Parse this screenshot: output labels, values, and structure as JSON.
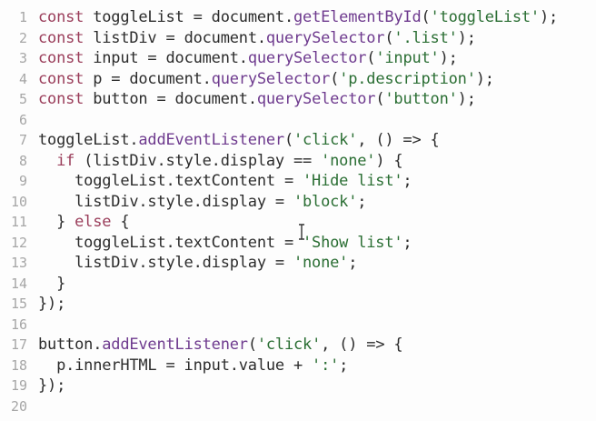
{
  "editor": {
    "language": "javascript",
    "colors": {
      "background": "#fdfdfd",
      "line_number": "#a6a6a6",
      "keyword": "#9a3d5a",
      "function": "#6e3a8e",
      "string": "#2a6e33",
      "default": "#2c2c2c"
    },
    "lines": [
      {
        "n": "1",
        "tokens": [
          [
            "kw",
            "const"
          ],
          [
            "plain",
            " toggleList = document."
          ],
          [
            "fn",
            "getElementById"
          ],
          [
            "plain",
            "("
          ],
          [
            "str",
            "'toggleList'"
          ],
          [
            "plain",
            ");"
          ]
        ]
      },
      {
        "n": "2",
        "tokens": [
          [
            "kw",
            "const"
          ],
          [
            "plain",
            " listDiv = document."
          ],
          [
            "fn",
            "querySelector"
          ],
          [
            "plain",
            "("
          ],
          [
            "str",
            "'.list'"
          ],
          [
            "plain",
            ");"
          ]
        ]
      },
      {
        "n": "3",
        "tokens": [
          [
            "kw",
            "const"
          ],
          [
            "plain",
            " input = document."
          ],
          [
            "fn",
            "querySelector"
          ],
          [
            "plain",
            "("
          ],
          [
            "str",
            "'input'"
          ],
          [
            "plain",
            ");"
          ]
        ]
      },
      {
        "n": "4",
        "tokens": [
          [
            "kw",
            "const"
          ],
          [
            "plain",
            " p = document."
          ],
          [
            "fn",
            "querySelector"
          ],
          [
            "plain",
            "("
          ],
          [
            "str",
            "'p.description'"
          ],
          [
            "plain",
            ");"
          ]
        ]
      },
      {
        "n": "5",
        "tokens": [
          [
            "kw",
            "const"
          ],
          [
            "plain",
            " button = document."
          ],
          [
            "fn",
            "querySelector"
          ],
          [
            "plain",
            "("
          ],
          [
            "str",
            "'button'"
          ],
          [
            "plain",
            ");"
          ]
        ]
      },
      {
        "n": "6",
        "tokens": []
      },
      {
        "n": "7",
        "tokens": [
          [
            "plain",
            "toggleList."
          ],
          [
            "fn",
            "addEventListener"
          ],
          [
            "plain",
            "("
          ],
          [
            "str",
            "'click'"
          ],
          [
            "plain",
            ", () => {"
          ]
        ]
      },
      {
        "n": "8",
        "tokens": [
          [
            "plain",
            "  "
          ],
          [
            "kw",
            "if"
          ],
          [
            "plain",
            " (listDiv.style.display == "
          ],
          [
            "str",
            "'none'"
          ],
          [
            "plain",
            ") {"
          ]
        ]
      },
      {
        "n": "9",
        "tokens": [
          [
            "plain",
            "    toggleList.textContent = "
          ],
          [
            "str",
            "'Hide list'"
          ],
          [
            "plain",
            ";"
          ]
        ]
      },
      {
        "n": "10",
        "tokens": [
          [
            "plain",
            "    listDiv.style.display = "
          ],
          [
            "str",
            "'block'"
          ],
          [
            "plain",
            ";"
          ]
        ]
      },
      {
        "n": "11",
        "tokens": [
          [
            "plain",
            "  } "
          ],
          [
            "kw",
            "else"
          ],
          [
            "plain",
            " {"
          ]
        ]
      },
      {
        "n": "12",
        "tokens": [
          [
            "plain",
            "    toggleList.textContent = "
          ],
          [
            "str",
            "'Show list'"
          ],
          [
            "plain",
            ";"
          ]
        ]
      },
      {
        "n": "13",
        "tokens": [
          [
            "plain",
            "    listDiv.style.display = "
          ],
          [
            "str",
            "'none'"
          ],
          [
            "plain",
            ";"
          ]
        ]
      },
      {
        "n": "14",
        "tokens": [
          [
            "plain",
            "  }"
          ]
        ]
      },
      {
        "n": "15",
        "tokens": [
          [
            "plain",
            "});"
          ]
        ]
      },
      {
        "n": "16",
        "tokens": []
      },
      {
        "n": "17",
        "tokens": [
          [
            "plain",
            "button."
          ],
          [
            "fn",
            "addEventListener"
          ],
          [
            "plain",
            "("
          ],
          [
            "str",
            "'click'"
          ],
          [
            "plain",
            ", () => {"
          ]
        ]
      },
      {
        "n": "18",
        "tokens": [
          [
            "plain",
            "  p.innerHTML = input.value + "
          ],
          [
            "str",
            "':'"
          ],
          [
            "plain",
            ";"
          ]
        ]
      },
      {
        "n": "19",
        "tokens": [
          [
            "plain",
            "});"
          ]
        ]
      },
      {
        "n": "20",
        "tokens": []
      }
    ],
    "cursor_icon": "i-beam-cursor-icon"
  }
}
